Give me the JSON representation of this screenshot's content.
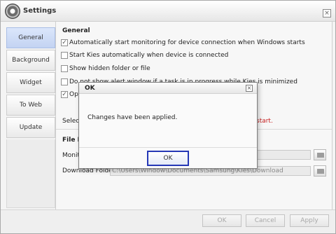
{
  "window": {
    "title": "Settings",
    "close_glyph": "×"
  },
  "sidebar": {
    "items": [
      {
        "label": "General"
      },
      {
        "label": "Background"
      },
      {
        "label": "Widget"
      },
      {
        "label": "To Web"
      },
      {
        "label": "Update"
      }
    ]
  },
  "general": {
    "title": "General",
    "options": [
      {
        "label": "Automatically start monitoring for device connection when Windows starts",
        "checked": true,
        "check_glyph": "✓"
      },
      {
        "label": "Start Kies automatically when device is connected",
        "checked": false,
        "check_glyph": ""
      },
      {
        "label": "Show hidden folder or file",
        "checked": false,
        "check_glyph": ""
      },
      {
        "label": "Do not show alert window if a task is in progress while Kies is minimized",
        "checked": false,
        "check_glyph": ""
      },
      {
        "label": "Opti",
        "checked": true,
        "check_glyph": "✓"
      }
    ],
    "select_fragment": "Select",
    "warning_fragment": "start."
  },
  "file_path": {
    "title": "File Pa",
    "rows": [
      {
        "label": "Monito",
        "value": ""
      },
      {
        "label": "Download Folder",
        "value": "C:\\Users\\Window\\Documents\\Samsung\\Kies\\Download"
      }
    ]
  },
  "footer": {
    "ok": "OK",
    "cancel": "Cancel",
    "apply": "Apply"
  },
  "dialog": {
    "title": "OK",
    "close_glyph": "×",
    "message": "Changes have been applied.",
    "ok_button": "OK"
  },
  "icons": {
    "app": "gear-icon",
    "folder": "folder-icon",
    "close": "close-icon",
    "check": "checkmark-icon"
  }
}
